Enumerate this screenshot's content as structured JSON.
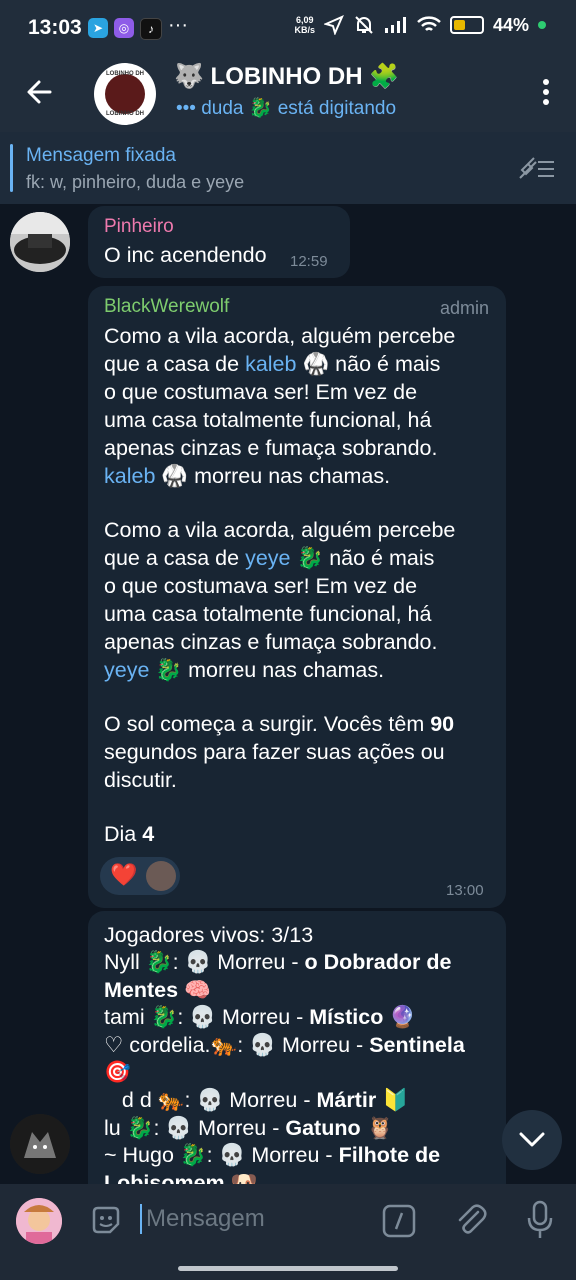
{
  "status": {
    "time": "13:03",
    "dots": "···",
    "speed_top": "6,09",
    "speed_bottom": "KB/s",
    "battery_pct": "44%",
    "battery_level": 0.44
  },
  "header": {
    "title": "🐺 LOBINHO DH 🧩",
    "typing": "••• duda 🐉 está digitando",
    "avatar_text": "LOBINHO DH"
  },
  "pinned": {
    "title": "Mensagem fixada",
    "text": "fk: w, pinheiro, duda e yeye"
  },
  "messages": {
    "m1": {
      "sender": "Pinheiro",
      "text": "O inc acendendo",
      "time": "12:59"
    },
    "m2": {
      "sender": "BlackWerewolf",
      "badge": "admin",
      "p1_a": "Como a vila acorda, alguém percebe\nque a casa de ",
      "p1_link": "kaleb",
      "p1_b": " 🥋 não é mais\no que costumava ser! Em vez de\numa casa totalmente funcional, há\napenas cinzas e fumaça sobrando.",
      "p1_link2": "kaleb",
      "p1_c": " 🥋 morreu nas chamas.",
      "p2_a": "Como a vila acorda, alguém percebe\nque a casa de ",
      "p2_link": "yeye",
      "p2_b": " 🐉 não é mais\no que costumava ser! Em vez de\numa casa totalmente funcional, há\napenas cinzas e fumaça sobrando.",
      "p2_link2": "yeye",
      "p2_c": " 🐉 morreu nas chamas.",
      "p3_a": "O sol começa a surgir. Vocês têm ",
      "p3_num": "90",
      "p3_b": "\nsegundos para fazer suas ações ou\ndiscutir.",
      "day_label": "Dia ",
      "day_num": "4",
      "time": "13:00",
      "reaction": "❤️"
    },
    "m3": {
      "heading": "Jogadores vivos: 3/13",
      "lines": [
        {
          "a": "Nyll 🐉: 💀 Morreu - ",
          "b": "o Dobrador de"
        },
        {
          "a": "",
          "b": "Mentes 🧠"
        },
        {
          "a": "tami 🐉: 💀 Morreu - ",
          "b": "Místico 🔮"
        },
        {
          "a": "♡ cordelia.🐅: 💀 Morreu - ",
          "b": "Sentinela"
        },
        {
          "a": "🎯",
          "b": ""
        },
        {
          "a": "   d d 🐅: 💀 Morreu - ",
          "b": "Mártir 🔰"
        },
        {
          "a": "lu 🐉: 💀 Morreu - ",
          "b": "Gatuno 🦉"
        },
        {
          "a": "~ Hugo 🐉: 💀 Morreu - ",
          "b": "Filhote de"
        },
        {
          "a": "",
          "b": "Lobisomem 🐶"
        }
      ]
    }
  },
  "input": {
    "placeholder": "Mensagem"
  },
  "colors": {
    "accent": "#6ab3f3",
    "pinheiro": "#ee7aae",
    "blackwerewolf": "#7ecc6e"
  }
}
